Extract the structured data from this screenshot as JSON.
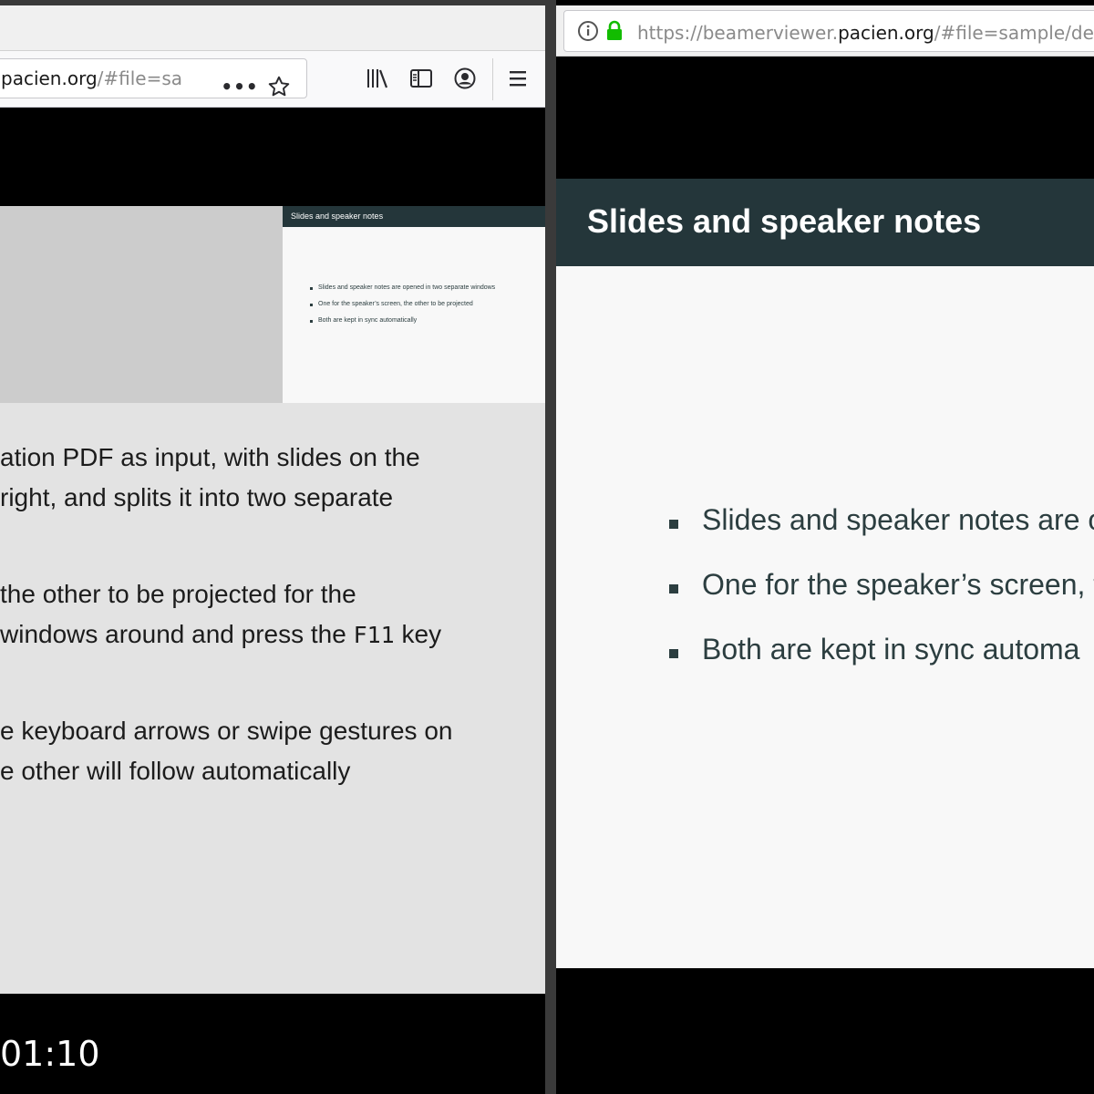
{
  "left_window": {
    "url": {
      "host": "pacien.org",
      "rest": "/#file=sam"
    },
    "current_slide_thumb": {
      "title": "Slides and speaker notes",
      "bullets": [
        "Slides and speaker notes are opened in two separate windows",
        "One for the speaker’s screen, the other to be projected",
        "Both are kept in sync automatically"
      ]
    },
    "notes": {
      "para1_line1": "ation PDF as input, with slides on the",
      "para1_line2": "right, and splits it into two separate",
      "para2_line1": "the other to be projected for the",
      "para2_line2_a": "windows around and press the ",
      "para2_key": "F11",
      "para2_line2_b": " key",
      "para3_line1": "e keyboard arrows or swipe gestures on",
      "para3_line2": "e other will follow automatically"
    },
    "timer": "01:10"
  },
  "right_window": {
    "url": {
      "prefix": "https://beamerviewer.",
      "domain": "pacien.org",
      "suffix": "/#file=sample/dem"
    },
    "slide": {
      "title": "Slides and speaker notes",
      "bullets": [
        "Slides and speaker notes are o",
        "One for the speaker’s screen, t",
        "Both are kept in sync automa"
      ]
    }
  },
  "colors": {
    "slide_header": "#24363a",
    "lock_green": "#12bc00",
    "notes_bg": "#e3e3e3"
  },
  "icons": [
    "more-icon",
    "star-icon",
    "library-icon",
    "sidebar-icon",
    "account-icon",
    "menu-icon",
    "info-icon",
    "lock-icon"
  ]
}
